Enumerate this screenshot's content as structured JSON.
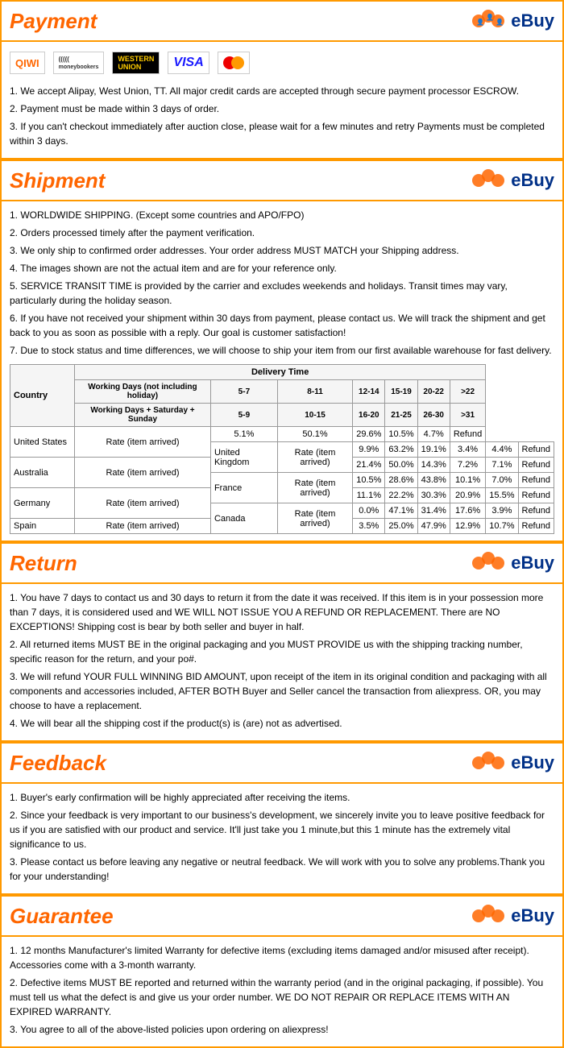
{
  "sections": {
    "payment": {
      "title": "Payment",
      "content": [
        "1. We accept Alipay, West Union, TT. All major credit cards are accepted through secure payment processor ESCROW.",
        "2. Payment must be made within 3 days of order.",
        "3. If you can't checkout immediately after auction close, please wait for a few minutes and retry Payments must be completed within 3 days."
      ]
    },
    "shipment": {
      "title": "Shipment",
      "content": [
        "1. WORLDWIDE SHIPPING. (Except some countries and APO/FPO)",
        "2. Orders processed timely after the payment verification.",
        "3. We only ship to confirmed order addresses. Your order address MUST MATCH your Shipping address.",
        "4. The images shown are not the actual item and are for your reference only.",
        "5. SERVICE TRANSIT TIME is provided by the carrier and excludes weekends and holidays. Transit times may vary, particularly during the holiday season.",
        "6. If you have not received your shipment within 30 days from payment, please contact us. We will track the shipment and get back to you as soon as possible with a reply. Our goal is customer satisfaction!",
        "7. Due to stock status and time differences, we will choose to ship your item from our first available warehouse for fast delivery."
      ],
      "table": {
        "col_headers": [
          "5-7",
          "8-11",
          "12-14",
          "15-19",
          "20-22",
          ">22"
        ],
        "sub_col_headers": [
          "5-9",
          "10-15",
          "16-20",
          "21-25",
          "26-30",
          ">31"
        ],
        "rows": [
          {
            "country": "United States",
            "rate": "Rate (item arrived)",
            "vals": [
              "5.1%",
              "50.1%",
              "29.6%",
              "10.5%",
              "4.7%",
              "Refund"
            ]
          },
          {
            "country": "United Kingdom",
            "rate": "Rate (item arrived)",
            "vals": [
              "9.9%",
              "63.2%",
              "19.1%",
              "3.4%",
              "4.4%",
              "Refund"
            ]
          },
          {
            "country": "Australia",
            "rate": "Rate (item arrived)",
            "vals": [
              "21.4%",
              "50.0%",
              "14.3%",
              "7.2%",
              "7.1%",
              "Refund"
            ]
          },
          {
            "country": "France",
            "rate": "Rate (item arrived)",
            "vals": [
              "10.5%",
              "28.6%",
              "43.8%",
              "10.1%",
              "7.0%",
              "Refund"
            ]
          },
          {
            "country": "Germany",
            "rate": "Rate (item arrived)",
            "vals": [
              "11.1%",
              "22.2%",
              "30.3%",
              "20.9%",
              "15.5%",
              "Refund"
            ]
          },
          {
            "country": "Canada",
            "rate": "Rate (item arrived)",
            "vals": [
              "0.0%",
              "47.1%",
              "31.4%",
              "17.6%",
              "3.9%",
              "Refund"
            ]
          },
          {
            "country": "Spain",
            "rate": "Rate (item arrived)",
            "vals": [
              "3.5%",
              "25.0%",
              "47.9%",
              "12.9%",
              "10.7%",
              "Refund"
            ]
          }
        ]
      }
    },
    "return": {
      "title": "Return",
      "content": [
        "1. You have 7 days to contact us and 30 days to return it from the date it was received. If this item is in your possession more than 7 days, it is considered used and WE WILL NOT ISSUE YOU A REFUND OR REPLACEMENT. There are NO EXCEPTIONS! Shipping cost is bear by both seller and buyer in half.",
        "2. All returned items MUST BE in the original packaging and you MUST PROVIDE us with the shipping tracking number, specific reason for the return, and your po#.",
        "3. We will refund YOUR FULL WINNING BID AMOUNT, upon receipt of the item in its original condition and packaging with all components and accessories included, AFTER BOTH Buyer and Seller cancel the transaction from aliexpress. OR, you may choose to have a replacement.",
        "4. We will bear all the shipping cost if the product(s) is (are) not as advertised."
      ]
    },
    "feedback": {
      "title": "Feedback",
      "content": [
        "1. Buyer's early confirmation will be highly appreciated after receiving the items.",
        "2. Since your feedback is very important to our business's development, we sincerely invite you to leave positive feedback for us if you are satisfied with our product and service. It'll just take you 1 minute,but this 1 minute has the extremely vital significance to us.",
        "3. Please contact us before leaving any negative or neutral feedback. We will work with you to solve any problems.Thank you for your understanding!"
      ]
    },
    "guarantee": {
      "title": "Guarantee",
      "content": [
        "1. 12 months Manufacturer's limited Warranty for defective items (excluding items damaged and/or misused after receipt). Accessories come with a 3-month warranty.",
        "2. Defective items MUST BE reported and returned within the warranty period (and in the original packaging, if possible). You must tell us what the defect is and give us your order number. WE DO NOT REPAIR OR REPLACE ITEMS WITH AN EXPIRED WARRANTY.",
        "3. You agree to all of the above-listed policies upon ordering on aliexpress!"
      ]
    },
    "ebuy_label": "eBuy",
    "delivery_time_label": "Delivery Time",
    "country_label": "Country",
    "working_days_label": "Working Days (not including holiday)",
    "working_days_sat_label": "Working Days + Saturday + Sunday"
  }
}
